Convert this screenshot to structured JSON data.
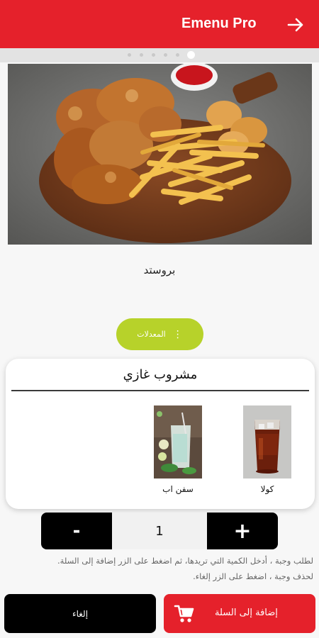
{
  "appbar": {
    "title": "Emenu Pro",
    "back_icon": "arrow-right-icon"
  },
  "pager": {
    "count": 6,
    "active_index": 5
  },
  "item": {
    "name": "بروستد"
  },
  "modifiers": {
    "label": "المعدلات",
    "icon": "kebab-menu-icon"
  },
  "option_group": {
    "title": "مشروب غازي",
    "options": [
      {
        "label": "كولا"
      },
      {
        "label": "سفن اب"
      }
    ]
  },
  "quantity": {
    "value": "1",
    "minus_label": "-",
    "plus_label": "+"
  },
  "instructions": {
    "line1": "لطلب وجبة ، أدخل الكمية التي تريدها، ثم اضغط على الزر إضافة إلى السلة.",
    "line2": "لحذف وجبة ، اضغط على الزر إلغاء."
  },
  "actions": {
    "cancel_label": "إلغاء",
    "add_label": "إضافة إلى السلة",
    "cart_icon": "cart-icon"
  },
  "colors": {
    "primary": "#e5212b",
    "accent": "#b7d22a",
    "dark": "#000000"
  }
}
